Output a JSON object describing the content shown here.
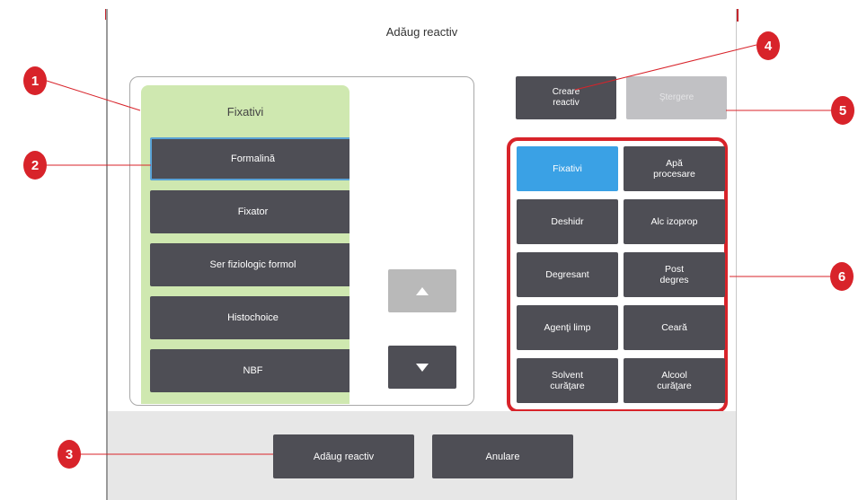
{
  "dialog": {
    "title": "Adăug reactiv"
  },
  "group_list": {
    "title": "Fixativi",
    "items": [
      "Formalină",
      "Fixator",
      "Ser fiziologic formol",
      "Histochoice",
      "NBF"
    ],
    "selected_index": 0
  },
  "actions_top": {
    "create_label": "Creare\nreactiv",
    "delete_label": "Ştergere"
  },
  "reagent_groups": [
    {
      "label": "Fixativi",
      "active": true
    },
    {
      "label": "Apă\nprocesare",
      "active": false
    },
    {
      "label": "Deshidr",
      "active": false
    },
    {
      "label": "Alc izoprop",
      "active": false
    },
    {
      "label": "Degresant",
      "active": false
    },
    {
      "label": "Post\ndegres",
      "active": false
    },
    {
      "label": "Agenţi limp",
      "active": false
    },
    {
      "label": "Ceară",
      "active": false
    },
    {
      "label": "Solvent\ncurăţare",
      "active": false
    },
    {
      "label": "Alcool\ncurăţare",
      "active": false
    }
  ],
  "footer": {
    "add_label": "Adăug reactiv",
    "cancel_label": "Anulare"
  },
  "callouts": [
    "1",
    "2",
    "3",
    "4",
    "5",
    "6"
  ],
  "colors": {
    "button_dark": "#4e4e55",
    "accent_blue": "#3aa1e5",
    "group_panel": "#cfe8b0",
    "callout_red": "#d8232a"
  }
}
